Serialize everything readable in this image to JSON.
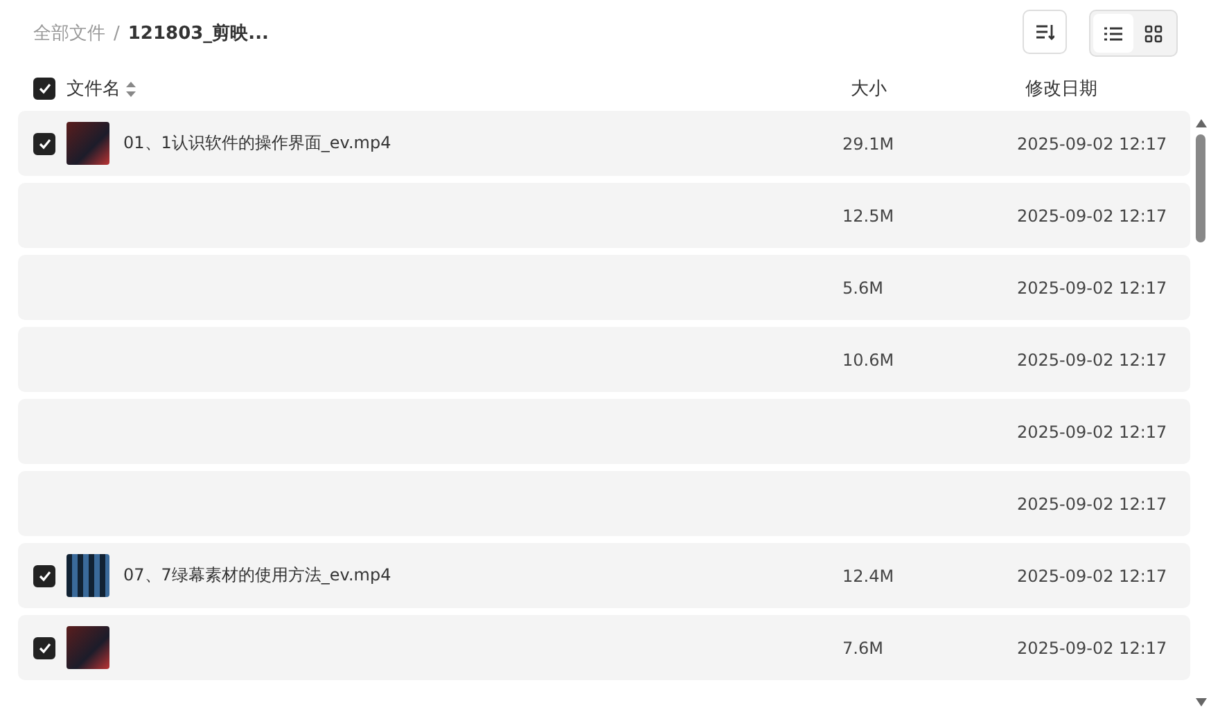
{
  "breadcrumb": {
    "root": "全部文件",
    "separator": "/",
    "current": "121803_剪映..."
  },
  "view_toggle": [
    {
      "kind": "list",
      "selected": true
    },
    {
      "kind": "grid",
      "selected": false
    }
  ],
  "table": {
    "select_all_checked": true,
    "columns": [
      "文件名",
      "大小",
      "修改日期"
    ],
    "rows": [
      {
        "checked": true,
        "thumbnail": true,
        "name": "01、1认识软件的操作界面_ev.mp4",
        "size": "29.1M",
        "modified": "2025-09-02 12:17"
      },
      {
        "size": "12.5M",
        "modified": "2025-09-02 12:17"
      },
      {
        "size": "5.6M",
        "modified": "2025-09-02 12:17"
      },
      {
        "size": "10.6M",
        "modified": "2025-09-02 12:17"
      },
      {
        "modified": "2025-09-02 12:17"
      },
      {
        "modified": "2025-09-02 12:17"
      },
      {
        "checked": true,
        "thumbnail": true,
        "name": "07、7绿幕素材的使用方法_ev.mp4",
        "size": "12.4M",
        "modified": "2025-09-02 12:17"
      },
      {
        "checked": true,
        "thumbnail": true,
        "size": "7.6M",
        "modified": "2025-09-02 12:17"
      }
    ]
  }
}
